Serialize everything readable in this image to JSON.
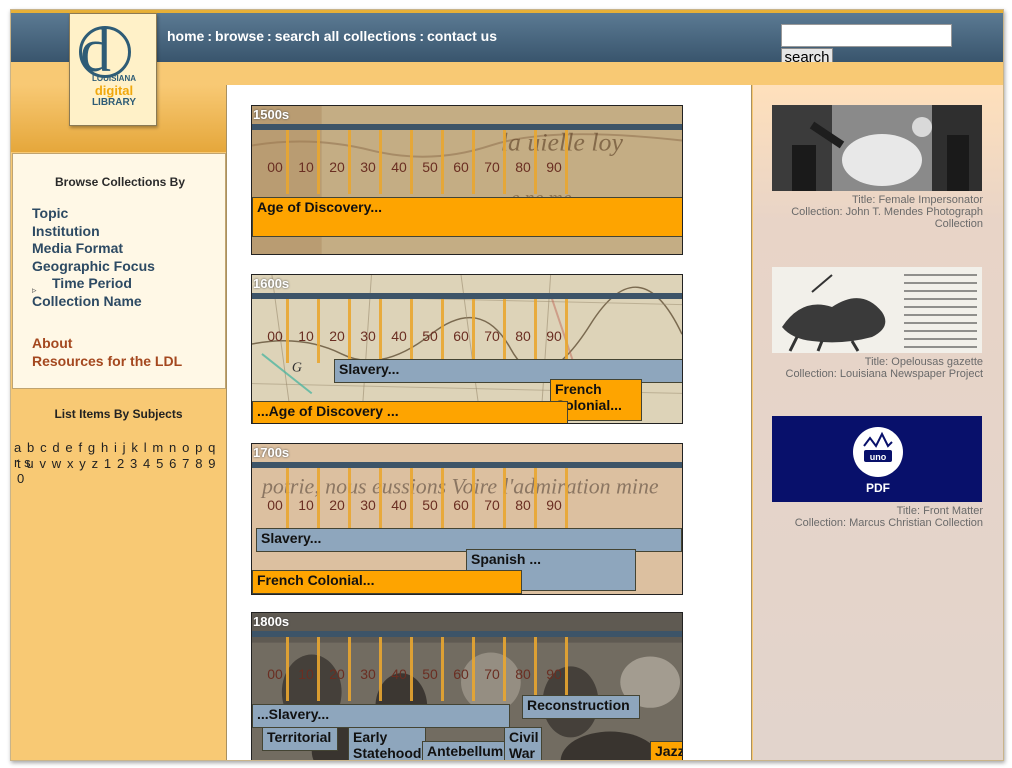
{
  "nav": {
    "home": "home",
    "browse": "browse",
    "search_all": "search all collections",
    "contact": "contact us",
    "separator": ":"
  },
  "search": {
    "button": "search",
    "value": ""
  },
  "logo": {
    "line1": "LOUISIANA",
    "line2": "digital",
    "line3": "LIBRARY"
  },
  "sidebar": {
    "browse_heading": "Browse Collections By",
    "items": [
      "Topic",
      "Institution",
      "Media Format",
      "Geographic Focus",
      "Time Period",
      "Collection Name"
    ],
    "about": "About",
    "resources": "Resources for the LDL",
    "list_heading": "List Items By Subjects",
    "letters_line1": "a b c d e f g h i j k l m n o p q r s",
    "letters_line2": "t u v w x y z 1 2 3 4 5 6 7 8 9 0"
  },
  "timeline": {
    "decades": [
      "00",
      "10",
      "20",
      "30",
      "40",
      "50",
      "60",
      "70",
      "80",
      "90"
    ],
    "centuries": [
      {
        "label": "1500s",
        "bars": [
          {
            "text": "Age of Discovery..."
          }
        ]
      },
      {
        "label": "1600s",
        "bars": [
          {
            "text": "Slavery..."
          },
          {
            "text": "French Colonial..."
          },
          {
            "text": "...Age of Discovery ..."
          }
        ]
      },
      {
        "label": "1700s",
        "bars": [
          {
            "text": "Slavery..."
          },
          {
            "text": "Spanish ..."
          },
          {
            "text": "French Colonial..."
          }
        ]
      },
      {
        "label": "1800s",
        "bars": [
          {
            "text": "Reconstruction"
          },
          {
            "text": "...Slavery..."
          },
          {
            "text": "Territorial"
          },
          {
            "text": "Early Statehood"
          },
          {
            "text": "Antebellum"
          },
          {
            "text": "Civil War"
          },
          {
            "text": "Jazz"
          }
        ]
      }
    ]
  },
  "featured": [
    {
      "title": "Title: Female Impersonator",
      "collection": "Collection: John T. Mendes Photograph Collection"
    },
    {
      "title": "Title: Opelousas gazette",
      "collection": "Collection: Louisiana Newspaper Project"
    },
    {
      "title": "Title: Front Matter",
      "collection": "Collection: Marcus Christian Collection",
      "badge": "PDF",
      "badge_logo": "uno"
    }
  ],
  "colors": {
    "nav_blue": "#3d5a73",
    "accent_orange": "#fea400",
    "slate": "#8ea6bd",
    "sidebar_yellow": "#f8c974"
  }
}
